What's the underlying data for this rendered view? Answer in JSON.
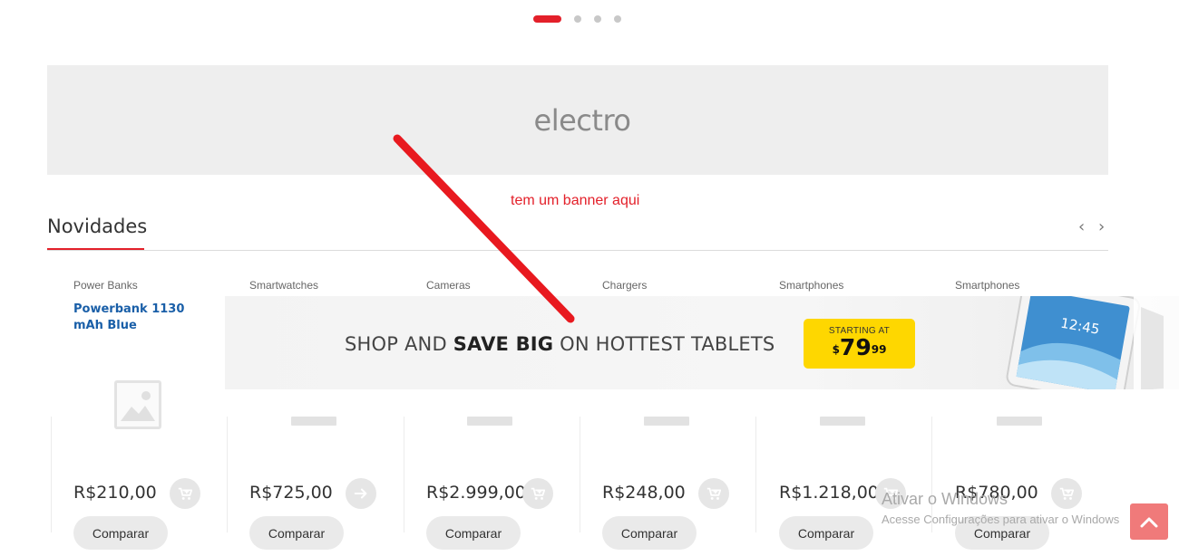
{
  "carousel": {
    "dot_count": 4,
    "active_index": 0
  },
  "top_banner": {
    "text": "electro"
  },
  "annotation": {
    "text": "tem um banner aqui",
    "color": "#e3202a"
  },
  "section": {
    "title": "Novidades",
    "prev_icon": "‹",
    "next_icon": "›"
  },
  "products": [
    {
      "category": "Power Banks",
      "name": "Powerbank 1130 mAh Blue",
      "price": "R$210,00",
      "action_icon": "add-to-cart-icon",
      "compare_label": "Comparar"
    },
    {
      "category": "Smartwatches",
      "name": "",
      "price": "R$725,00",
      "action_icon": "arrow-right-icon",
      "compare_label": "Comparar"
    },
    {
      "category": "Cameras",
      "name": "",
      "price": "R$2.999,00",
      "action_icon": "add-to-cart-icon",
      "compare_label": "Comparar"
    },
    {
      "category": "Chargers",
      "name": "",
      "price": "R$248,00",
      "action_icon": "add-to-cart-icon",
      "compare_label": "Comparar"
    },
    {
      "category": "Smartphones",
      "name": "",
      "price": "R$1.218,00",
      "action_icon": "add-to-cart-icon",
      "compare_label": "Comparar"
    },
    {
      "category": "Smartphones",
      "name": "",
      "price": "R$780,00",
      "action_icon": "add-to-cart-icon",
      "compare_label": "Comparar"
    }
  ],
  "tablet_banner": {
    "text_prefix": "SHOP AND ",
    "text_bold": "SAVE BIG",
    "text_suffix": " ON HOTTEST TABLETS",
    "tag_label": "STARTING AT",
    "tag_currency": "$",
    "tag_whole": "79",
    "tag_cents": "99",
    "tablet_time": "12:45"
  },
  "watermark": {
    "title": "Ativar o Windows",
    "subtitle": "Acesse Configurações para ativar o Windows"
  },
  "colors": {
    "accent": "#e3202a",
    "link": "#1a5fa8",
    "tag": "#fed700",
    "scroll_top": "#f07a7a"
  }
}
